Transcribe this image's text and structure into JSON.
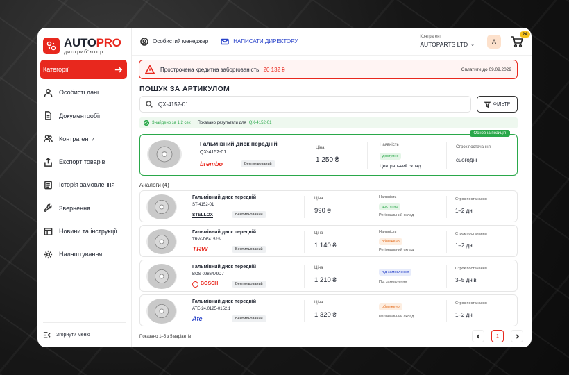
{
  "brand": {
    "name_main": "AUTO",
    "name_accent": "PRO",
    "subtitle": "дистриб'ютор"
  },
  "sidebar": {
    "items": [
      {
        "label": "Категорії",
        "icon": "grid-icon",
        "active": true
      },
      {
        "label": "Особисті дані",
        "icon": "user-icon"
      },
      {
        "label": "Документообіг",
        "icon": "document-icon"
      },
      {
        "label": "Контрагенти",
        "icon": "users-icon"
      },
      {
        "label": "Експорт товарів",
        "icon": "export-icon"
      },
      {
        "label": "Історія замовлення",
        "icon": "history-icon"
      },
      {
        "label": "Звернення",
        "icon": "wrench-icon"
      },
      {
        "label": "Новини та інструкції",
        "icon": "news-icon"
      },
      {
        "label": "Налаштування",
        "icon": "gear-icon"
      }
    ],
    "collapse_label": "Згорнути меню"
  },
  "topbar": {
    "manager_label": "Особистий менеджер",
    "director_label": "НАПИСАТИ ДИРЕКТОРУ",
    "contractor_caption": "Контрагент",
    "contractor_value": "AUTOPARTS LTD",
    "avatar_letter": "A",
    "cart_count": "24"
  },
  "alert": {
    "text": "Прострочена кредитна заборгованість:",
    "amount": "20 132 ₴",
    "pay_by": "Сплатити до 09.09.2029"
  },
  "search": {
    "title": "ПОШУК ЗА АРТИКУЛОМ",
    "value": "QX-4152-01",
    "filter_label": "ФІЛЬТР",
    "found_text": "Знайдено за 1,2 сек",
    "results_text": "Показано результати для",
    "results_query": "QX-4152-01"
  },
  "main_result": {
    "tag": "Основна позиція",
    "name": "Гальмівний диск передній",
    "article": "QX-4152-01",
    "brand": "brembo",
    "type": "Вентильований",
    "price_caption": "Ціна",
    "price": "1 250 ₴",
    "stock_caption": "Наявність",
    "stock_status": "доступно",
    "warehouse": "Центральний склад",
    "delivery_caption": "Строк постачання",
    "delivery": "сьогодні"
  },
  "analogs": {
    "title": "Аналоги (4)",
    "price_caption": "Ціна",
    "stock_caption": "Наявність",
    "delivery_caption": "Строк постачання",
    "items": [
      {
        "name": "Гальмівний диск передній",
        "article": "ST-4152-01",
        "brand": "STELLOX",
        "type": "Вентильований",
        "price": "990 ₴",
        "stock_status": "доступно",
        "stock_color": "green",
        "warehouse": "Регіональний склад",
        "delivery": "1–2 дні"
      },
      {
        "name": "Гальмівний диск передній",
        "article": "TRW-DF4152S",
        "brand": "TRW",
        "type": "Вентильований",
        "price": "1 140 ₴",
        "stock_status": "обмежено",
        "stock_color": "orange",
        "warehouse": "Регіональний склад",
        "delivery": "1–2 дні"
      },
      {
        "name": "Гальмівний диск передній",
        "article": "BOS-0986479D7",
        "brand": "BOSCH",
        "type": "Вентильований",
        "price": "1 210 ₴",
        "stock_status": "під замовлення",
        "stock_color": "blue",
        "warehouse": "Під замовлення",
        "delivery": "3–5 днів"
      },
      {
        "name": "Гальмівний диск передній",
        "article": "ATE-24.0125-0152.1",
        "brand": "Ate",
        "type": "Вентильований",
        "price": "1 320 ₴",
        "stock_status": "обмежено",
        "stock_color": "orange",
        "warehouse": "Регіональний склад",
        "delivery": "1–2 дні"
      }
    ]
  },
  "footer": {
    "shown_text": "Показано 1–5 з 5 варіантів",
    "current_page": "1"
  },
  "colors": {
    "accent": "#e8281e",
    "success": "#2aa84a",
    "link": "#2741c9",
    "cart_badge": "#f6c21d"
  }
}
